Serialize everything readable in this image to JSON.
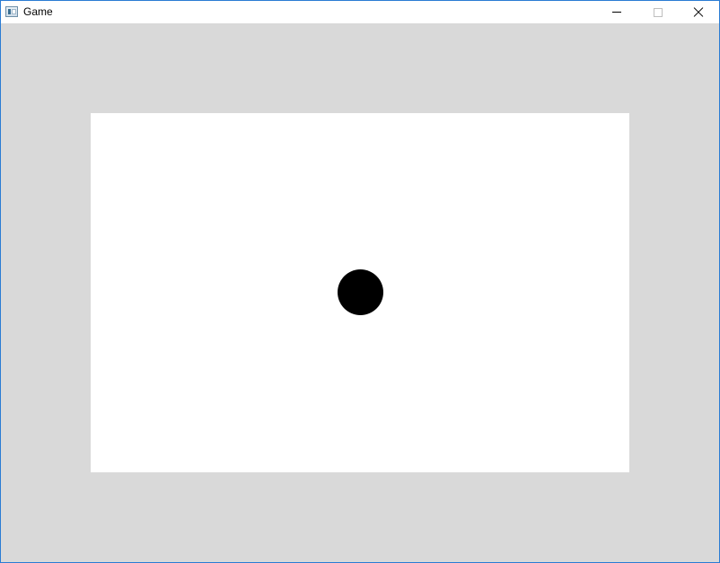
{
  "window": {
    "title": "Game",
    "icon": "application-icon",
    "frame_color": "#2b7cd3",
    "titlebar_color": "#ffffff",
    "controls": {
      "minimize": "minimize-icon",
      "maximize": "maximize-icon",
      "maximize_enabled": false,
      "close": "close-icon"
    }
  },
  "game": {
    "background_color": "#d9d9d9",
    "canvas_color": "#ffffff",
    "ball": {
      "shape": "circle",
      "color": "#000000"
    }
  }
}
